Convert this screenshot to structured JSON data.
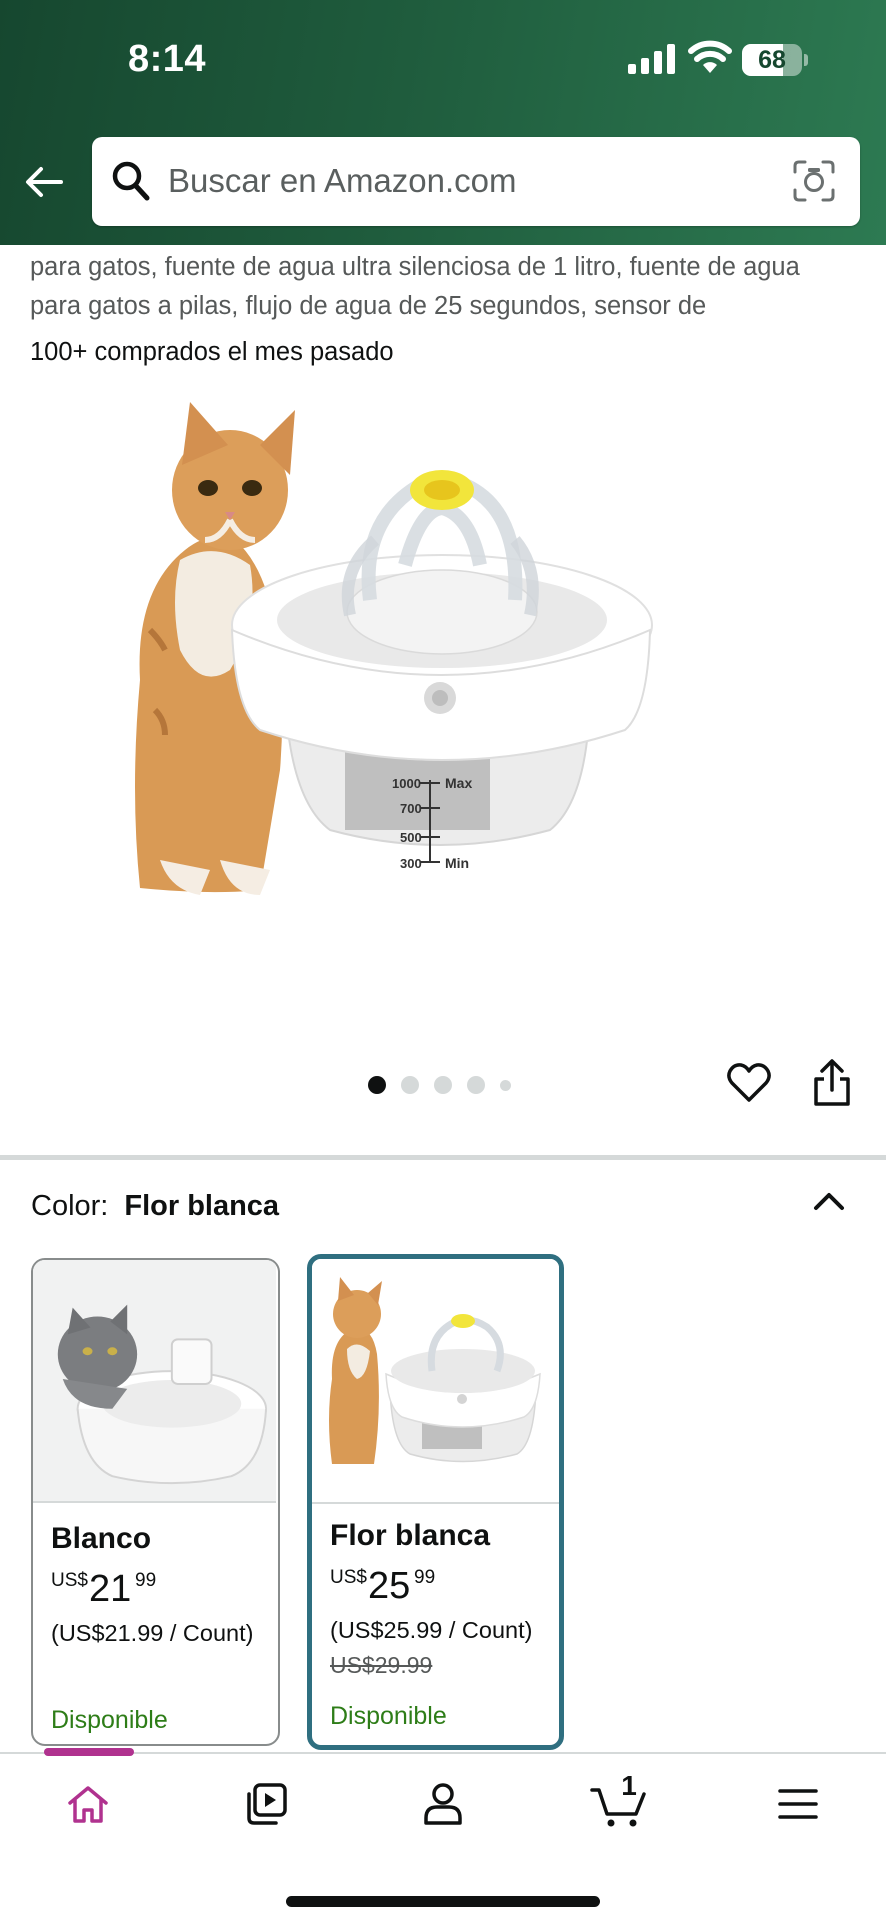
{
  "status_bar": {
    "time": "8:14",
    "battery_percent": "68",
    "battery_level": 0.68,
    "icons": [
      "cellular-signal-icon",
      "wifi-icon",
      "battery-icon"
    ]
  },
  "header": {
    "back_icon": "arrow-left-icon",
    "search_placeholder": "Buscar en Amazon.com",
    "search_icon": "magnifier-icon",
    "camera_icon": "camera-lens-icon",
    "gradient_colors": [
      "#16472f",
      "#2d7a52"
    ]
  },
  "product": {
    "description_lines": [
      "para gatos, fuente de agua ultra silenciosa de 1 litro, fuente de agua",
      "para gatos a pilas, flujo de agua de 25 segundos, sensor de"
    ],
    "bought_text": "100+ comprados el mes pasado",
    "image_labels": {
      "max": "Max",
      "mark_1000": "1000",
      "mark_700": "700",
      "mark_500": "500",
      "mark_300": "300",
      "min": "Min"
    },
    "image_count": 5,
    "active_image_index": 0,
    "actions": [
      "heart-icon",
      "share-icon"
    ]
  },
  "color_selector": {
    "label": "Color:",
    "selected": "Flor blanca",
    "toggle_icon": "chevron-up-icon",
    "variants": [
      {
        "name": "Blanco",
        "currency": "US$",
        "price_whole": "21",
        "price_fraction": "99",
        "unit_price": "(US$21.99 / Count)",
        "list_price": "",
        "availability": "Disponible",
        "selected": false
      },
      {
        "name": "Flor blanca",
        "currency": "US$",
        "price_whole": "25",
        "price_fraction": "99",
        "unit_price": "(US$25.99 / Count)",
        "list_price": "US$29.99",
        "availability": "Disponible",
        "selected": true
      }
    ],
    "accent_color": "#2f6f80",
    "availability_color": "#2e7d18"
  },
  "bottom_nav": {
    "items": [
      {
        "name": "home",
        "icon": "home-icon",
        "active": true
      },
      {
        "name": "video",
        "icon": "video-play-icon",
        "active": false
      },
      {
        "name": "account",
        "icon": "person-icon",
        "active": false
      },
      {
        "name": "cart",
        "icon": "cart-icon",
        "active": false
      },
      {
        "name": "menu",
        "icon": "hamburger-menu-icon",
        "active": false
      }
    ],
    "cart_count": "1",
    "active_color": "#b0328f"
  }
}
